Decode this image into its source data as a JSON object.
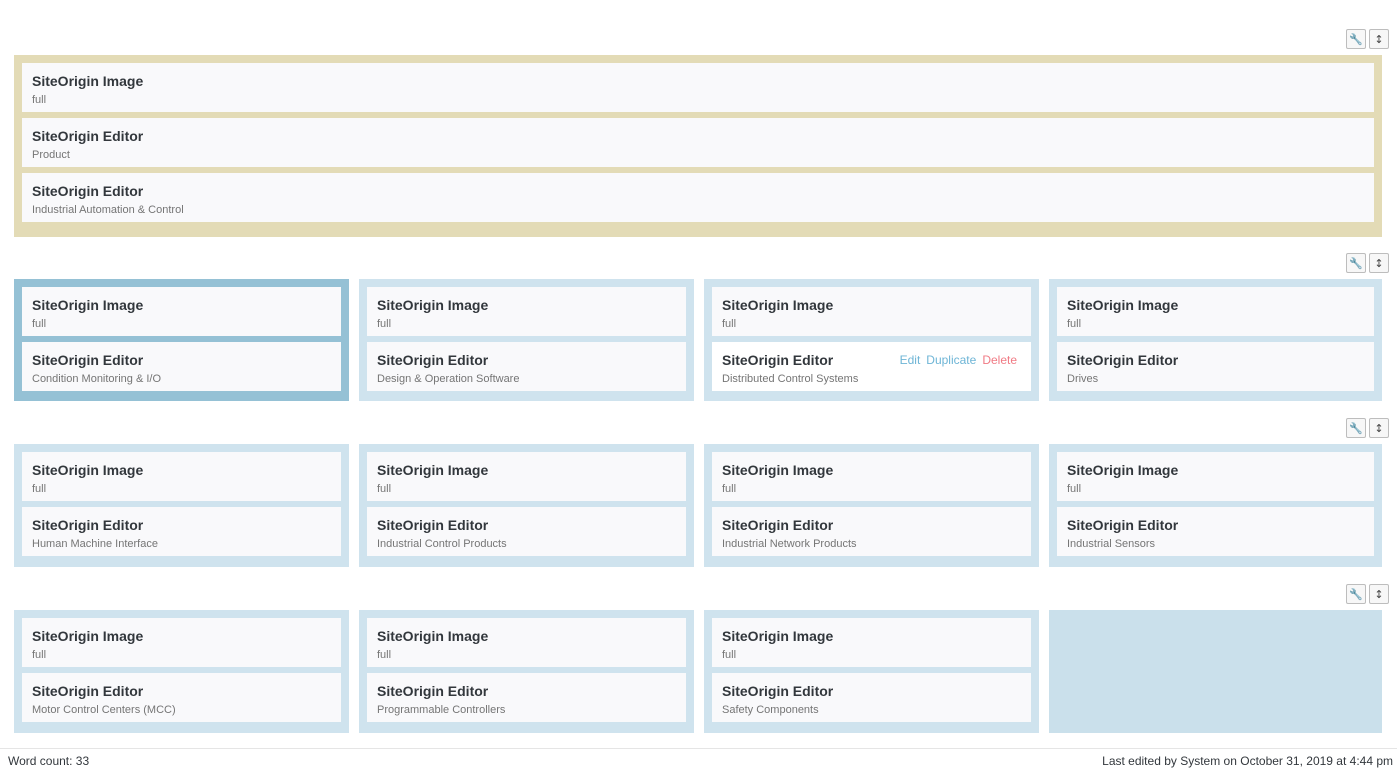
{
  "tools": {
    "settings_icon": "wrench-icon",
    "settings_glyph": "🔧",
    "move_icon": "move-icon",
    "move_glyph": "↕"
  },
  "rows": [
    {
      "widgets": [
        {
          "title": "SiteOrigin Image",
          "desc": "full"
        },
        {
          "title": "SiteOrigin Editor",
          "desc": "Product"
        },
        {
          "title": "SiteOrigin Editor",
          "desc": "Industrial Automation & Control"
        }
      ]
    },
    {
      "cells": [
        {
          "image_title": "SiteOrigin Image",
          "image_desc": "full",
          "editor_title": "SiteOrigin Editor",
          "editor_desc": "Condition Monitoring & I/O"
        },
        {
          "image_title": "SiteOrigin Image",
          "image_desc": "full",
          "editor_title": "SiteOrigin Editor",
          "editor_desc": "Design & Operation Software"
        },
        {
          "image_title": "SiteOrigin Image",
          "image_desc": "full",
          "editor_title": "SiteOrigin Editor",
          "editor_desc": "Distributed Control Systems"
        },
        {
          "image_title": "SiteOrigin Image",
          "image_desc": "full",
          "editor_title": "SiteOrigin Editor",
          "editor_desc": "Drives"
        }
      ]
    },
    {
      "cells": [
        {
          "image_title": "SiteOrigin Image",
          "image_desc": "full",
          "editor_title": "SiteOrigin Editor",
          "editor_desc": "Human Machine Interface"
        },
        {
          "image_title": "SiteOrigin Image",
          "image_desc": "full",
          "editor_title": "SiteOrigin Editor",
          "editor_desc": "Industrial Control Products"
        },
        {
          "image_title": "SiteOrigin Image",
          "image_desc": "full",
          "editor_title": "SiteOrigin Editor",
          "editor_desc": "Industrial Network Products"
        },
        {
          "image_title": "SiteOrigin Image",
          "image_desc": "full",
          "editor_title": "SiteOrigin Editor",
          "editor_desc": "Industrial Sensors"
        }
      ]
    },
    {
      "cells": [
        {
          "image_title": "SiteOrigin Image",
          "image_desc": "full",
          "editor_title": "SiteOrigin Editor",
          "editor_desc": "Motor Control Centers (MCC)"
        },
        {
          "image_title": "SiteOrigin Image",
          "image_desc": "full",
          "editor_title": "SiteOrigin Editor",
          "editor_desc": "Programmable Controllers"
        },
        {
          "image_title": "SiteOrigin Image",
          "image_desc": "full",
          "editor_title": "SiteOrigin Editor",
          "editor_desc": "Safety Components"
        }
      ]
    }
  ],
  "hover_actions": {
    "edit": "Edit",
    "duplicate": "Duplicate",
    "delete": "Delete"
  },
  "status": {
    "word_count": "Word count: 33",
    "last_edited": "Last edited by System on October 31, 2019 at 4:44 pm"
  },
  "colors": {
    "row1_bg": "#e3dbb6",
    "cell_bg": "#cfe3ee",
    "active_cell_bg": "#95c1d5",
    "delete": "#f07a84",
    "link": "#6eb5d6"
  }
}
